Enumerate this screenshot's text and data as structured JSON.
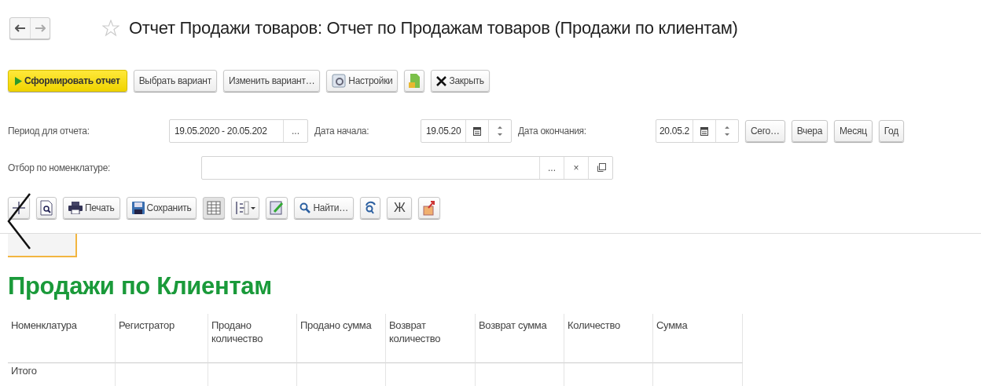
{
  "title": "Отчет Продажи товаров: Отчет по Продажам товаров (Продажи по клиентам)",
  "favorite": false,
  "toolbar": {
    "generate": "Сформировать отчет",
    "choose_variant": "Выбрать вариант",
    "edit_variant": "Изменить вариант…",
    "settings": "Настройки",
    "close": "Закрыть"
  },
  "period": {
    "label": "Период для отчета:",
    "value": "19.05.2020 - 20.05.202",
    "choice_button": "..."
  },
  "start_date": {
    "label": "Дата начала:",
    "value": "19.05.20"
  },
  "end_date": {
    "label": "Дата окончания:",
    "value": "20.05.2"
  },
  "quick_buttons": [
    "Сего…",
    "Вчера",
    "Месяц",
    "Год"
  ],
  "nomenclature": {
    "label": "Отбор по номенклатуре:",
    "choice_button": "...",
    "clear_button": "×"
  },
  "report_toolbar": {
    "print": "Печать",
    "save": "Сохранить",
    "find": "Найти…",
    "bold": "Ж"
  },
  "report": {
    "title": "Продажи по Клиентам",
    "columns": [
      "Номенклатура",
      "Регистратор",
      "Продано количество",
      "Продано сумма",
      "Возврат количество",
      "Возврат сумма",
      "Количество",
      "Сумма"
    ],
    "rows": [
      {
        "cells": [
          "Итого"
        ]
      }
    ]
  }
}
